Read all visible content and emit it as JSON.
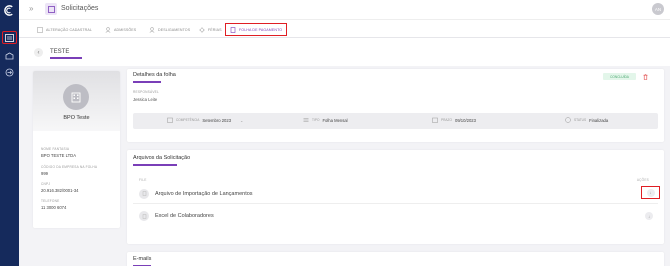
{
  "header": {
    "title": "Solicitações",
    "avatar_initials": "AN"
  },
  "tabs": [
    {
      "label": "ALTERAÇÃO CADASTRAL",
      "icon": "edit-icon"
    },
    {
      "label": "ADMISSÕES",
      "icon": "user-add-icon"
    },
    {
      "label": "DESLIGAMENTOS",
      "icon": "user-remove-icon"
    },
    {
      "label": "FÉRIAS",
      "icon": "sun-icon"
    },
    {
      "label": "FOLHA DE PAGAMENTO",
      "icon": "document-icon"
    }
  ],
  "subheader": {
    "title": "TESTE"
  },
  "profile": {
    "name": "BPO Teste",
    "fields": [
      {
        "label": "NOME FANTASIA",
        "value": "BPO TESTE LTDA"
      },
      {
        "label": "CÓDIGO DA EMPRESA NA FOLHA",
        "value": "999"
      },
      {
        "label": "CNPJ",
        "value": "20.916.382/0001-34"
      },
      {
        "label": "TELEFONE",
        "value": "11 3000 6074"
      }
    ]
  },
  "details": {
    "title": "Detalhes da folha",
    "status": "CONCLUÍDA",
    "responsavel_label": "RESPONSÁVEL",
    "responsavel": "Jessica Leite",
    "info": [
      {
        "label": "COMPETÊNCIA",
        "value": "Setembro 2023",
        "icon": "calendar-icon"
      },
      {
        "label": "TIPO",
        "value": "Folha Mensal",
        "icon": "list-icon"
      },
      {
        "label": "PRAZO",
        "value": "09/10/2023",
        "icon": "calendar-icon"
      },
      {
        "label": "STATUS",
        "value": "Finalizada",
        "icon": "check-icon"
      }
    ]
  },
  "arquivos": {
    "title": "Arquivos da Solicitação",
    "col_file": "FILE",
    "col_actions": "AÇÕES",
    "files": [
      {
        "name": "Arquivo de Importação de Lançamentos"
      },
      {
        "name": "Excel de Colaboradores"
      }
    ]
  },
  "emails": {
    "title": "E-mails"
  },
  "colors": {
    "accent": "#7a3fb8",
    "rail": "#152a5c",
    "highlight": "#e01e24",
    "success": "#4aa870"
  }
}
